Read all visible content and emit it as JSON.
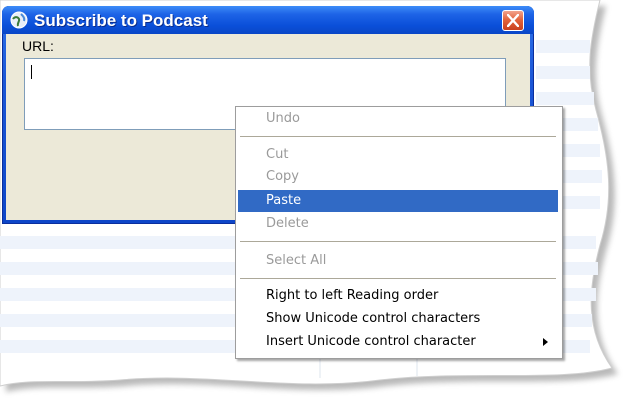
{
  "dialog": {
    "title": "Subscribe to Podcast",
    "url_label": "URL:",
    "url_value": ""
  },
  "context_menu": {
    "items": [
      {
        "label": "Undo",
        "enabled": false
      },
      {
        "label": "Cut",
        "enabled": false
      },
      {
        "label": "Copy",
        "enabled": false
      },
      {
        "label": "Paste",
        "enabled": true,
        "selected": true
      },
      {
        "label": "Delete",
        "enabled": false
      },
      {
        "label": "Select All",
        "enabled": false
      },
      {
        "label": "Right to left Reading order",
        "enabled": true
      },
      {
        "label": "Show Unicode control characters",
        "enabled": true
      },
      {
        "label": "Insert Unicode control character",
        "enabled": true,
        "submenu": true
      }
    ]
  },
  "colors": {
    "titlebar": "#0a4fd9",
    "menu_highlight": "#316ac5",
    "dialog_face": "#ece9d8",
    "close_button": "#e3643c"
  },
  "icons": {
    "title": "podcast-globe-icon",
    "close": "close-icon",
    "submenu": "chevron-right-icon"
  }
}
